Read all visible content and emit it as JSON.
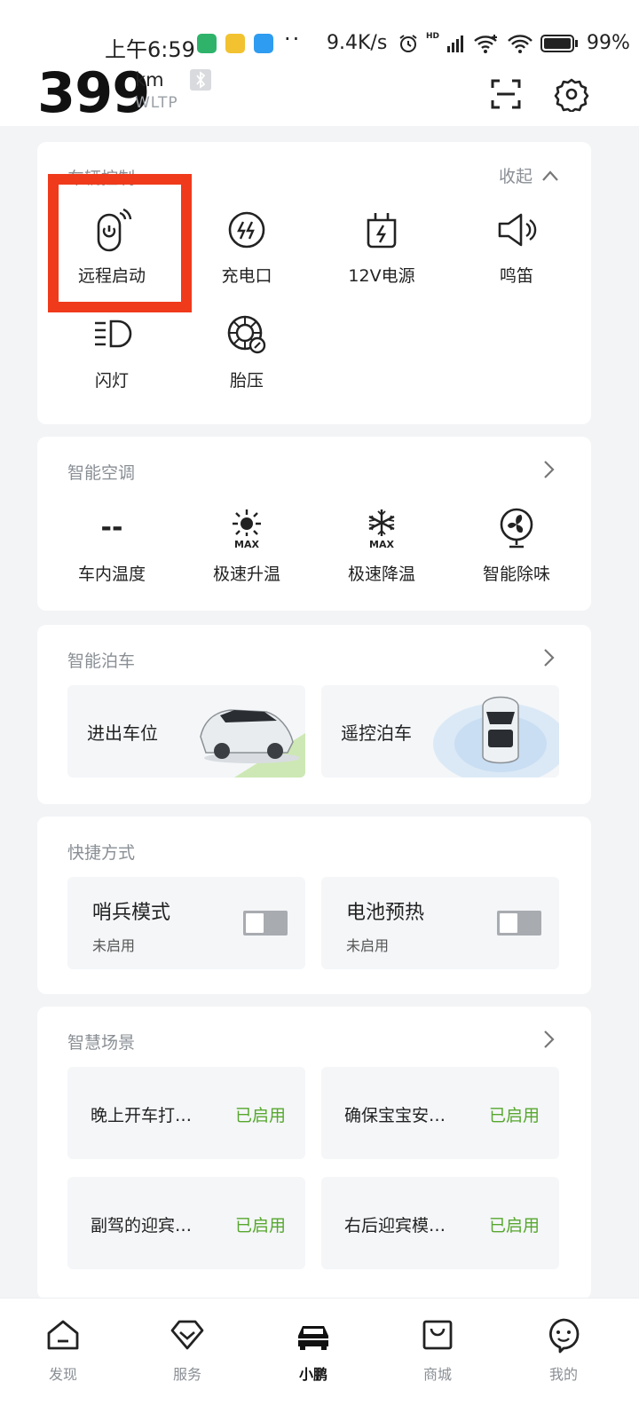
{
  "status_bar": {
    "time": "上午6:59",
    "dots": "··",
    "net_speed": "9.4K/s",
    "signal_tag": "HD",
    "battery_pct": "99%"
  },
  "header": {
    "range_value": "399",
    "range_unit": "km",
    "range_standard": "WLTP",
    "icons": [
      "bluetooth-icon",
      "scan-icon",
      "gear-icon"
    ]
  },
  "vehicle_control": {
    "title": "车辆控制",
    "collapse_label": "收起",
    "items": [
      {
        "label": "远程启动",
        "icon": "remote-start-icon"
      },
      {
        "label": "充电口",
        "icon": "charge-port-icon"
      },
      {
        "label": "12V电源",
        "icon": "battery-12v-icon"
      },
      {
        "label": "鸣笛",
        "icon": "horn-icon"
      },
      {
        "label": "闪灯",
        "icon": "flash-light-icon"
      },
      {
        "label": "胎压",
        "icon": "tire-pressure-icon"
      }
    ]
  },
  "climate": {
    "title": "智能空调",
    "items": [
      {
        "label": "车内温度",
        "value": "--"
      },
      {
        "label": "极速升温",
        "icon": "sun-max-icon",
        "badge": "MAX"
      },
      {
        "label": "极速降温",
        "icon": "snow-max-icon",
        "badge": "MAX"
      },
      {
        "label": "智能除味",
        "icon": "fan-icon"
      }
    ]
  },
  "parking": {
    "title": "智能泊车",
    "tiles": [
      {
        "label": "进出车位"
      },
      {
        "label": "遥控泊车"
      }
    ]
  },
  "shortcuts": {
    "title": "快捷方式",
    "tiles": [
      {
        "title": "哨兵模式",
        "status": "未启用"
      },
      {
        "title": "电池预热",
        "status": "未启用"
      }
    ]
  },
  "scenes": {
    "title": "智慧场景",
    "tiles": [
      {
        "name": "晚上开车打…",
        "status": "已启用"
      },
      {
        "name": "确保宝宝安…",
        "status": "已启用"
      },
      {
        "name": "副驾的迎宾…",
        "status": "已启用"
      },
      {
        "name": "右后迎宾模…",
        "status": "已启用"
      }
    ]
  },
  "tabbar": {
    "tabs": [
      {
        "label": "发现",
        "icon": "home-icon"
      },
      {
        "label": "服务",
        "icon": "service-icon"
      },
      {
        "label": "小鹏",
        "icon": "car-icon",
        "active": true
      },
      {
        "label": "商城",
        "icon": "shop-icon"
      },
      {
        "label": "我的",
        "icon": "profile-icon"
      }
    ]
  },
  "colors": {
    "accent_green": "#57a72e",
    "highlight_red": "#f03a1c",
    "background": "#f3f4f6"
  }
}
